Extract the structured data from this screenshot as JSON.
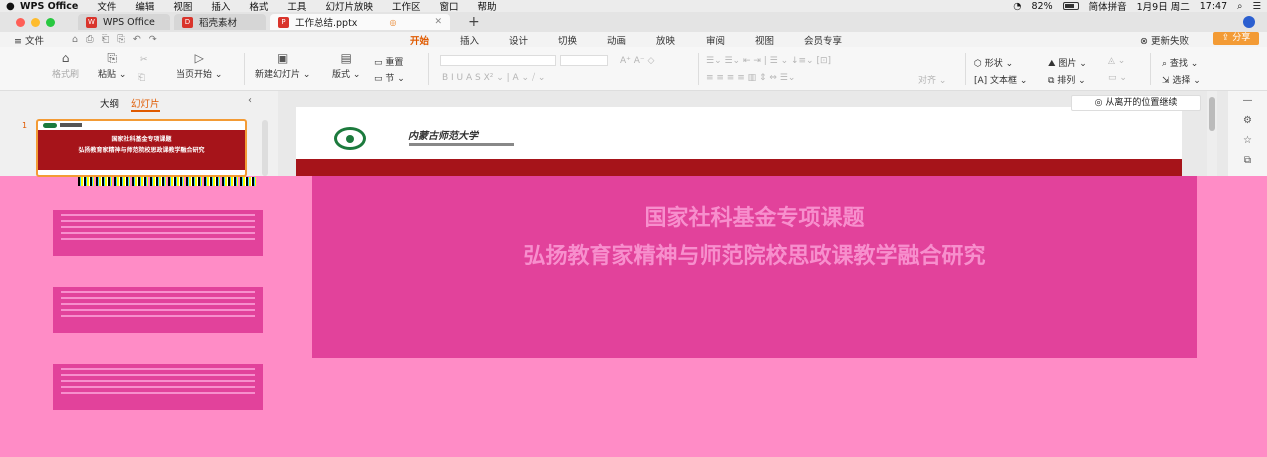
{
  "menubar": {
    "apple": "",
    "items": [
      "WPS Office",
      "文件",
      "编辑",
      "视图",
      "插入",
      "格式",
      "工具",
      "幻灯片放映",
      "工作区",
      "窗口",
      "帮助"
    ],
    "battery_percent": "82%",
    "battery_level": 0.82,
    "input_method": "简体拼音",
    "date": "1月9日 周二",
    "time": "17:47"
  },
  "tabs": {
    "items": [
      {
        "label": "WPS Office",
        "color": "#d9342b"
      },
      {
        "label": "稻壳素材",
        "color": "#d9342b"
      }
    ],
    "active": {
      "label": "工作总结.pptx",
      "color": "#d9342b"
    },
    "plus": "+"
  },
  "ribbon_tabs": {
    "file": "文件",
    "items": [
      "开始",
      "插入",
      "设计",
      "切换",
      "动画",
      "放映",
      "审阅",
      "视图",
      "会员专享"
    ],
    "active_index": 0,
    "update": "更新失败",
    "share": "分享"
  },
  "ribbon": {
    "format_painter": "格式刷",
    "paste": "粘贴",
    "start_from_current": "当页开始",
    "new_slide": "新建幻灯片",
    "layout": "版式",
    "reset": "重置",
    "section": "节",
    "align": "对齐",
    "shape": "形状",
    "picture": "图片",
    "textbox": "文本框",
    "arrange": "排列",
    "find": "查找",
    "select": "选择"
  },
  "panel": {
    "tab_outline": "大纲",
    "tab_slides": "幻灯片",
    "slide_number": "1",
    "thumb_line1": "国家社科基金专项课题",
    "thumb_line2": "弘扬教育家精神与师范院校思政课教学融合研究"
  },
  "slide": {
    "university_name": "内蒙古师范大学",
    "title_line1": "国家社科基金专项课题",
    "title_line2": "弘扬教育家精神与师范院校思政课教学融合研究"
  },
  "resume_button": "从离开的位置继续",
  "colors": {
    "accent": "#e05a00",
    "slide_red": "#a6141a",
    "glitch_background": "#ff8cc6",
    "glitch_box": "#e2429b",
    "emblem_green": "#1c7a3d"
  }
}
